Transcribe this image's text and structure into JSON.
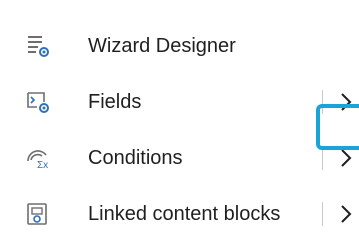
{
  "menu": {
    "items": [
      {
        "label": "Wizard Designer",
        "icon": "wizard-designer-icon",
        "has_submenu": false
      },
      {
        "label": "Fields",
        "icon": "fields-icon",
        "has_submenu": true
      },
      {
        "label": "Conditions",
        "icon": "conditions-icon",
        "has_submenu": true,
        "focused": true
      },
      {
        "label": "Linked content blocks",
        "icon": "linked-content-blocks-icon",
        "has_submenu": true
      }
    ]
  },
  "colors": {
    "icon_gray": "#6e6e6e",
    "icon_blue": "#2e6fb7",
    "focus_ring": "#1aa3d9",
    "separator": "#c8c8c8",
    "text": "#1f1f1f"
  }
}
